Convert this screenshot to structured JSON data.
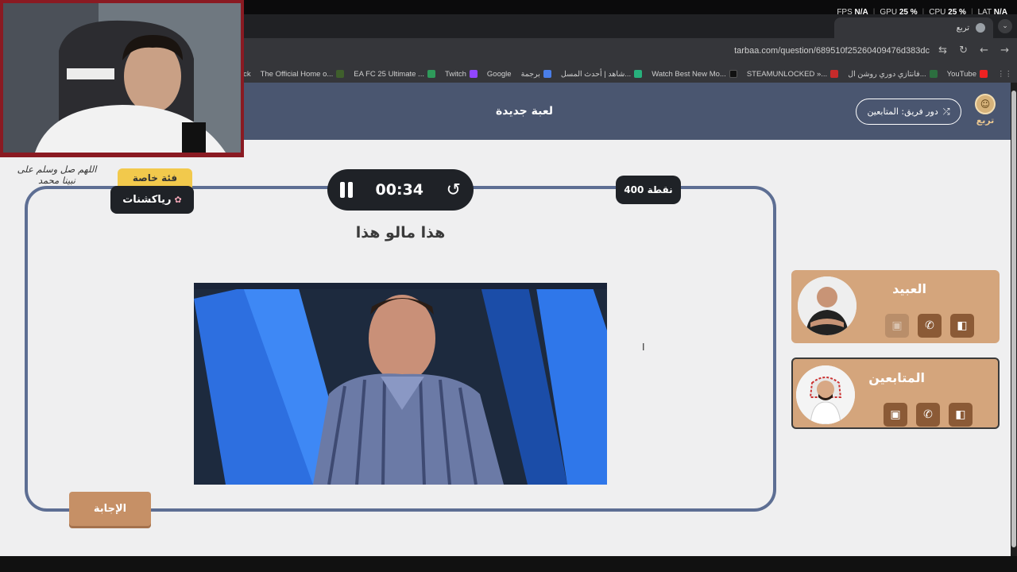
{
  "overlay": {
    "stats": [
      {
        "label": "FPS",
        "value": "N/A"
      },
      {
        "label": "GPU",
        "value": "25 %"
      },
      {
        "label": "CPU",
        "value": "25 %"
      },
      {
        "label": "LAT",
        "value": "N/A"
      }
    ]
  },
  "browser": {
    "tab_title": "تربع",
    "url": "tarbaa.com/question/689510f2526040947​6d383dc",
    "bookmarks": [
      "YouTube",
      "فانتازي دوري روشن ال...",
      "STEAMUNLOCKED »...",
      "Watch Best New Mo...",
      "شاهد | أحدث المسل...",
      "برجمة",
      "Google",
      "Twitch",
      "EA FC 25 Ultimate ...",
      "The Official Home o...",
      "Kick"
    ]
  },
  "header": {
    "logo_text": "تربع",
    "turn_label": "دور فريق: المتابعين",
    "new_game": "لعبة جديدة"
  },
  "question": {
    "category_badge": "فئة خاصة",
    "category": "رياكشنات",
    "timer": "00:34",
    "points": "400 نقطة",
    "text": "هذا مالو هذا",
    "answer_button": "الإجابة"
  },
  "teams": [
    {
      "name": "العبيد"
    },
    {
      "name": "المتابعين"
    }
  ],
  "webcam_caption": "اللهم صل وسلم على نبينا محمد",
  "colors": {
    "header": "#4a5670",
    "card_border": "#5d6e93",
    "team_card": "#d4a57c",
    "answer_button": "#c69066",
    "category_badge": "#f2c94c"
  }
}
